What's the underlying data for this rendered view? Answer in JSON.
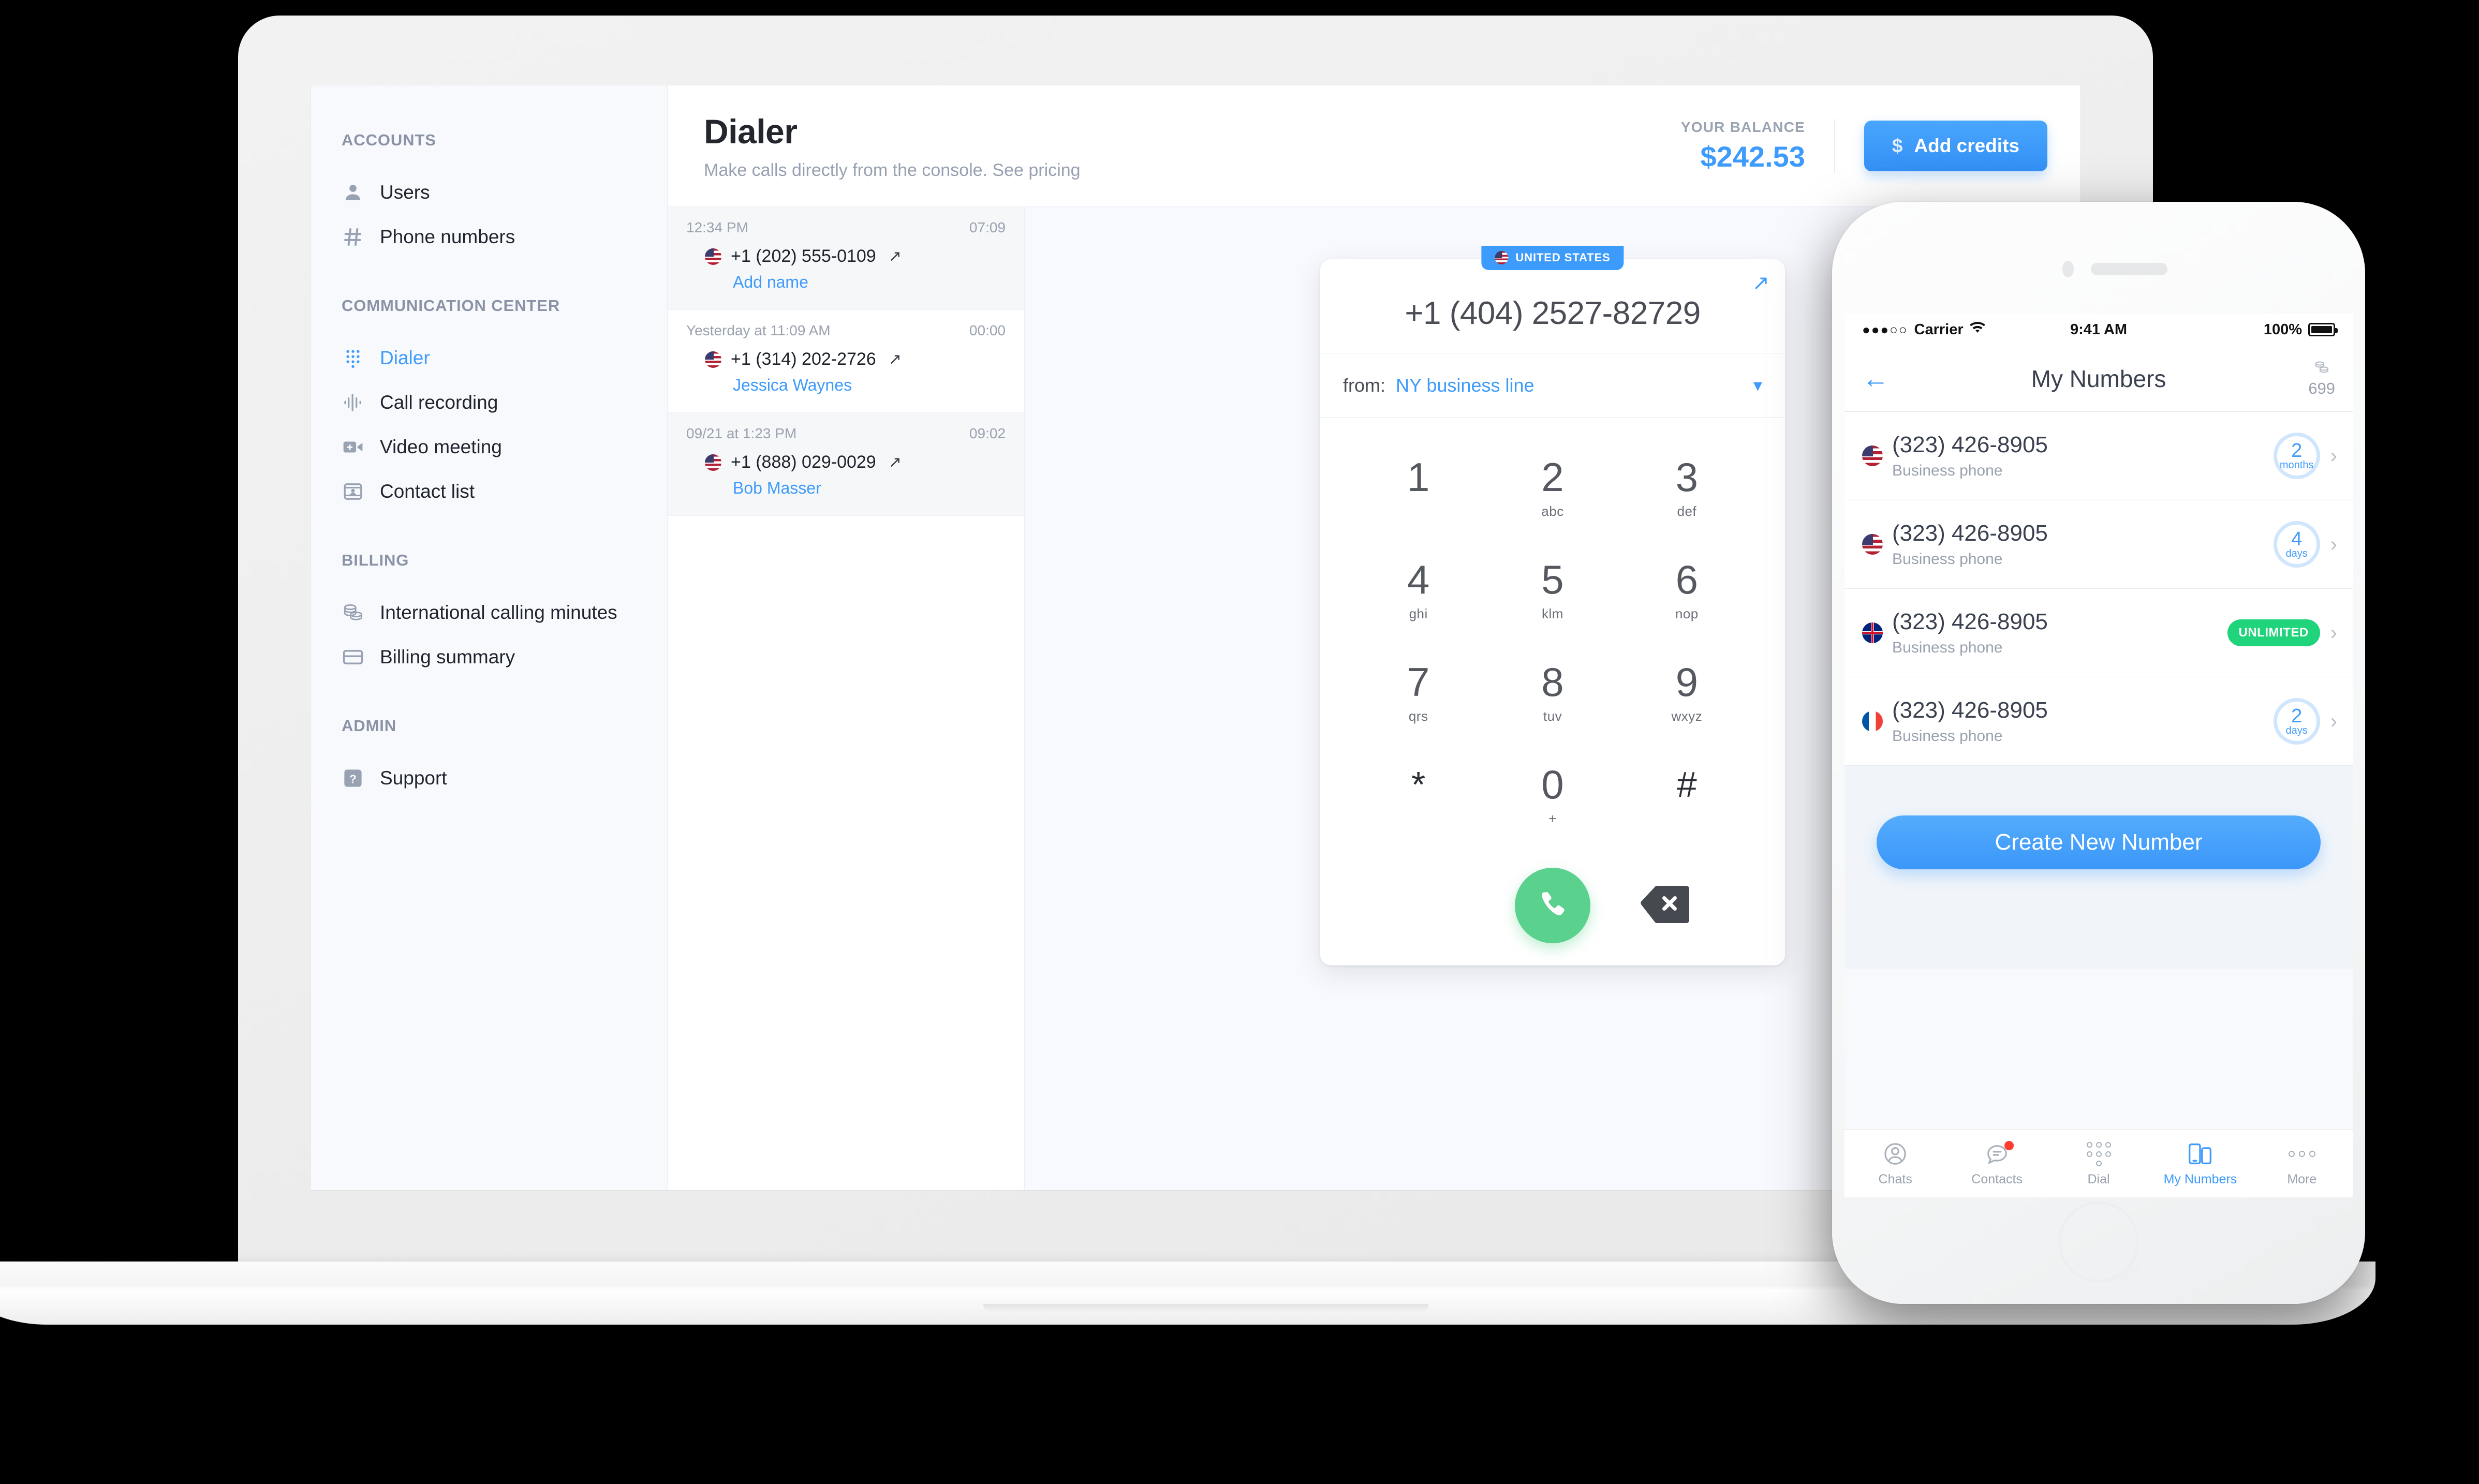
{
  "console": {
    "sidebar": {
      "groups": [
        {
          "label": "ACCOUNTS",
          "items": [
            {
              "label": "Users",
              "icon": "user-icon",
              "active": false
            },
            {
              "label": "Phone numbers",
              "icon": "hash-icon",
              "active": false
            }
          ]
        },
        {
          "label": "COMMUNICATION CENTER",
          "items": [
            {
              "label": "Dialer",
              "icon": "dialpad-icon",
              "active": true
            },
            {
              "label": "Call recording",
              "icon": "waveform-icon",
              "active": false
            },
            {
              "label": "Video meeting",
              "icon": "video-camera-icon",
              "active": false
            },
            {
              "label": "Contact list",
              "icon": "contact-card-icon",
              "active": false
            }
          ]
        },
        {
          "label": "BILLING",
          "items": [
            {
              "label": "International calling minutes",
              "icon": "coins-icon",
              "active": false
            },
            {
              "label": "Billing summary",
              "icon": "credit-card-icon",
              "active": false
            }
          ]
        },
        {
          "label": "ADMIN",
          "items": [
            {
              "label": "Support",
              "icon": "question-icon",
              "active": false
            }
          ]
        }
      ]
    },
    "header": {
      "title": "Dialer",
      "subtitle": "Make calls directly from the console. See pricing",
      "balance_label": "YOUR BALANCE",
      "balance_value": "$242.53",
      "add_credits_label": "Add credits",
      "add_credits_icon": "dollar-icon"
    },
    "call_history": [
      {
        "timestamp": "12:34 PM",
        "duration": "07:09",
        "number": "+1 (202) 555-0109",
        "flag": "us",
        "direction_icon": "outgoing-call-arrow-icon",
        "name": "Add name"
      },
      {
        "timestamp": "Yesterday at 11:09 AM",
        "duration": "00:00",
        "number": "+1 (314) 202-2726",
        "flag": "us",
        "direction_icon": "outgoing-call-arrow-icon",
        "name": "Jessica Waynes"
      },
      {
        "timestamp": "09/21 at 1:23 PM",
        "duration": "09:02",
        "number": "+1 (888) 029-0029",
        "flag": "us",
        "direction_icon": "outgoing-call-arrow-icon",
        "name": "Bob Masser"
      }
    ],
    "dialer": {
      "country_badge": "UNITED STATES",
      "country_flag": "us",
      "expand_icon": "expand-arrows-icon",
      "number": "+1 (404) 2527-82729",
      "from_label": "from:",
      "from_value": "NY business line",
      "chevron_icon": "chevron-down-icon",
      "keys": [
        {
          "digit": "1",
          "sub": ""
        },
        {
          "digit": "2",
          "sub": "abc"
        },
        {
          "digit": "3",
          "sub": "def"
        },
        {
          "digit": "4",
          "sub": "ghi"
        },
        {
          "digit": "5",
          "sub": "klm"
        },
        {
          "digit": "6",
          "sub": "nop"
        },
        {
          "digit": "7",
          "sub": "qrs"
        },
        {
          "digit": "8",
          "sub": "tuv"
        },
        {
          "digit": "9",
          "sub": "wxyz"
        },
        {
          "digit": "*",
          "sub": ""
        },
        {
          "digit": "0",
          "sub": "+"
        },
        {
          "digit": "#",
          "sub": ""
        }
      ],
      "call_button_icon": "phone-handset-icon",
      "backspace_icon": "backspace-icon"
    }
  },
  "phone": {
    "status_bar": {
      "signal": "●●●○○",
      "carrier": "Carrier",
      "wifi_icon": "wifi-icon",
      "time": "9:41 AM",
      "battery_percent": "100%",
      "battery_icon": "battery-full-icon"
    },
    "nav": {
      "back_icon": "arrow-left-icon",
      "title": "My Numbers",
      "credits_icon": "coins-icon",
      "credits_value": "699"
    },
    "numbers": [
      {
        "flag": "us",
        "number": "(323) 426-8905",
        "subtitle": "Business phone",
        "badge_type": "circle",
        "badge_value": "2",
        "badge_unit": "months"
      },
      {
        "flag": "us",
        "number": "(323) 426-8905",
        "subtitle": "Business phone",
        "badge_type": "circle",
        "badge_value": "4",
        "badge_unit": "days"
      },
      {
        "flag": "gb",
        "number": "(323) 426-8905",
        "subtitle": "Business phone",
        "badge_type": "pill",
        "badge_value": "UNLIMITED",
        "badge_unit": ""
      },
      {
        "flag": "fr",
        "number": "(323) 426-8905",
        "subtitle": "Business phone",
        "badge_type": "circle",
        "badge_value": "2",
        "badge_unit": "days"
      }
    ],
    "create_button_label": "Create New Number",
    "tabs": [
      {
        "label": "Chats",
        "icon": "avatar-icon",
        "active": false,
        "badge": false
      },
      {
        "label": "Contacts",
        "icon": "chat-bubble-icon",
        "active": false,
        "badge": true
      },
      {
        "label": "Dial",
        "icon": "dialpad-icon",
        "active": false,
        "badge": false
      },
      {
        "label": "My Numbers",
        "icon": "devices-icon",
        "active": true,
        "badge": false
      },
      {
        "label": "More",
        "icon": "ellipsis-icon",
        "active": false,
        "badge": false
      }
    ]
  },
  "colors": {
    "accent_blue": "#3d9bfb",
    "call_green": "#5bd18e",
    "unlimited_green": "#1fd47a",
    "badge_red": "#ff3b30"
  }
}
